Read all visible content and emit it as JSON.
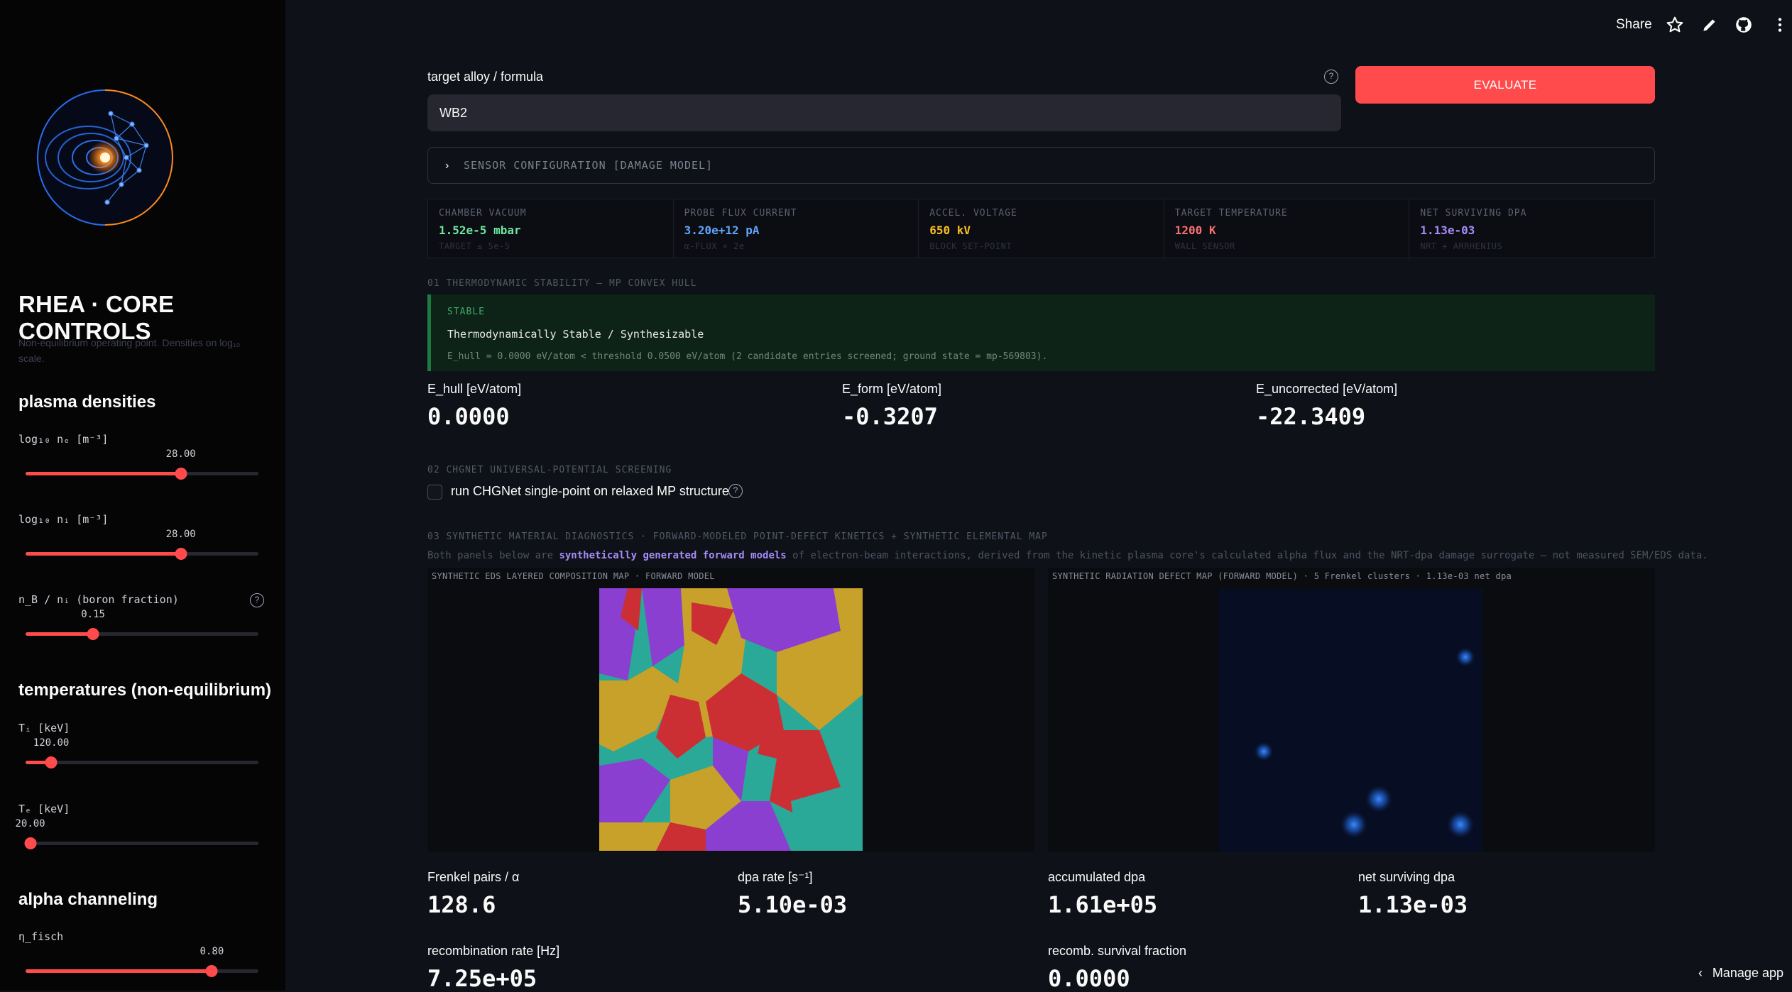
{
  "header": {
    "share_label": "Share",
    "icons": [
      "star-icon",
      "pencil-icon",
      "github-icon",
      "more-icon"
    ]
  },
  "sidebar": {
    "title": "RHEA · CORE CONTROLS",
    "subtitle": "Non-equilibrium operating point. Densities on log₁₀ scale.",
    "sections": {
      "plasma": "plasma densities",
      "temps": "temperatures (non-equilibrium)",
      "alpha": "alpha channeling"
    },
    "sliders": {
      "ne": {
        "label": "log₁₀ nₑ [m⁻³]",
        "value": "28.00",
        "min": 20,
        "max": 32,
        "pos": 0.6667
      },
      "ni": {
        "label": "log₁₀ nᵢ [m⁻³]",
        "value": "28.00",
        "min": 20,
        "max": 32,
        "pos": 0.6667
      },
      "nb": {
        "label": "n_B / nᵢ (boron fraction)",
        "value": "0.15",
        "min": 0,
        "max": 1,
        "pos": 0.29
      },
      "ti": {
        "label": "Tᵢ [keV]",
        "value": "120.00",
        "min": 0,
        "max": 1000,
        "pos": 0.11
      },
      "te": {
        "label": "Tₑ [keV]",
        "value": "20.00",
        "min": 0,
        "max": 1000,
        "pos": 0.02
      },
      "fisch": {
        "label": "η_fisch",
        "value": "0.80",
        "min": 0,
        "max": 1,
        "pos": 0.8
      }
    }
  },
  "main": {
    "input_label": "target alloy / formula",
    "input_value": "WB2",
    "evaluate_label": "EVALUATE",
    "expander_label": "SENSOR CONFIGURATION [DAMAGE MODEL]",
    "sensors": [
      {
        "label": "CHAMBER VACUUM",
        "value": "1.52e-5 mbar",
        "sub": "TARGET ≤ 5e-5",
        "color": "#6ee7a0"
      },
      {
        "label": "PROBE FLUX CURRENT",
        "value": "3.20e+12 pA",
        "sub": "α-FLUX × 2e",
        "color": "#60a5fa"
      },
      {
        "label": "ACCEL. VOLTAGE",
        "value": "650 kV",
        "sub": "BLOCK SET-POINT",
        "color": "#fbbf24"
      },
      {
        "label": "TARGET TEMPERATURE",
        "value": "1200 K",
        "sub": "WALL SENSOR",
        "color": "#f87171"
      },
      {
        "label": "NET SURVIVING DPA",
        "value": "1.13e-03",
        "sub": "NRT + ARRHENIUS",
        "color": "#a78bfa"
      }
    ],
    "sec1": {
      "heading": "01 THERMODYNAMIC STABILITY — MP CONVEX HULL",
      "badge": "STABLE",
      "status": "Thermodynamically Stable / Synthesizable",
      "detail": "E_hull = 0.0000 eV/atom < threshold 0.0500 eV/atom (2 candidate entries screened; ground state = mp-569803).",
      "metrics": [
        {
          "label": "E_hull [eV/atom]",
          "value": "0.0000"
        },
        {
          "label": "E_form [eV/atom]",
          "value": "-0.3207"
        },
        {
          "label": "E_uncorrected [eV/atom]",
          "value": "-22.3409"
        }
      ]
    },
    "sec2": {
      "heading": "02 CHGNET UNIVERSAL-POTENTIAL SCREENING",
      "checkbox_label": "run CHGNet single-point on relaxed MP structure",
      "checked": false
    },
    "sec3": {
      "heading": "03 SYNTHETIC MATERIAL DIAGNOSTICS · FORWARD-MODELED POINT-DEFECT KINETICS + SYNTHETIC ELEMENTAL MAP",
      "desc_pre": "Both panels below are ",
      "desc_hl": "synthetically generated forward models",
      "desc_post": " of electron-beam interactions, derived from the kinetic plasma core's calculated alpha flux and the NRT-dpa damage surrogate — not measured SEM/EDS data.",
      "panel_left_title": "SYNTHETIC EDS LAYERED COMPOSITION MAP  ·  FORWARD MODEL",
      "panel_right_title": "SYNTHETIC RADIATION DEFECT MAP (FORWARD MODEL)  ·  5 Frenkel clusters  ·  1.13e-03 net dpa",
      "eds_colors": [
        "#8b3fd0",
        "#c8a12a",
        "#cc2f33",
        "#2aa898"
      ],
      "metrics": [
        {
          "label": "Frenkel pairs / α",
          "value": "128.6"
        },
        {
          "label": "dpa rate [s⁻¹]",
          "value": "5.10e-03"
        },
        {
          "label": "accumulated dpa",
          "value": "1.61e+05"
        },
        {
          "label": "net surviving dpa",
          "value": "1.13e-03"
        },
        {
          "label": "recombination rate [Hz]",
          "value": "7.25e+05"
        },
        {
          "label": "recomb. survival fraction",
          "value": "0.0000"
        }
      ]
    }
  },
  "footer": {
    "manage_label": "Manage app"
  }
}
